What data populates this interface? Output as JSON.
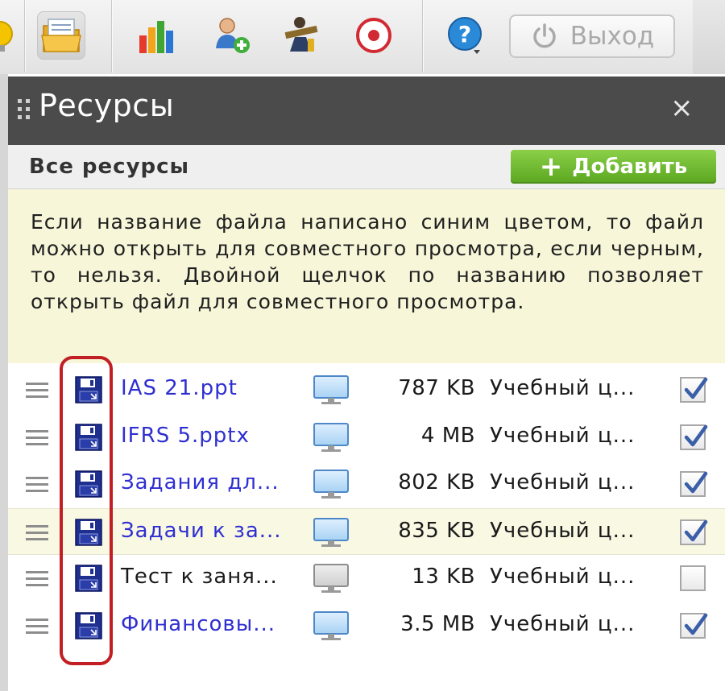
{
  "toolbar": {
    "icons": [
      "lightbulb-icon",
      "resources-folder-icon",
      "bar-chart-icon",
      "add-user-icon",
      "presenter-icon",
      "record-icon",
      "help-icon"
    ],
    "exit_label": "Выход"
  },
  "panel": {
    "title": "Ресурсы",
    "close_glyph": "×",
    "subheader_title": "Все ресурсы",
    "add_button_label": "Добавить",
    "add_button_glyph": "+",
    "notice": "Если название файла написано синим цветом, то файл можно открыть для совместного просмотра, если черным, то нельзя. Двойной щелчок по названию позволяет открыть файл для совместного просмотра."
  },
  "colors": {
    "header_bg": "#4b4b4b",
    "notice_bg": "#f7f6d9",
    "link_blue": "#2f2fd1",
    "add_green": "#6fbb32",
    "highlight_outline": "#c21f24"
  },
  "files": [
    {
      "name": "IAS 21.ppt",
      "size": "787 KB",
      "owner": "Учебный ц...",
      "shareable": true,
      "checked": true
    },
    {
      "name": "IFRS 5.pptx",
      "size": "4 MB",
      "owner": "Учебный ц...",
      "shareable": true,
      "checked": true
    },
    {
      "name": "Задания дл...",
      "size": "802 KB",
      "owner": "Учебный ц...",
      "shareable": true,
      "checked": true
    },
    {
      "name": "Задачи к за...",
      "size": "835 KB",
      "owner": "Учебный ц...",
      "shareable": true,
      "checked": true,
      "highlighted": true
    },
    {
      "name": "Тест к заня...",
      "size": "13 KB",
      "owner": "Учебный ц...",
      "shareable": false,
      "checked": false
    },
    {
      "name": "Финансовы...",
      "size": "3.5 MB",
      "owner": "Учебный ц...",
      "shareable": true,
      "checked": true
    }
  ]
}
